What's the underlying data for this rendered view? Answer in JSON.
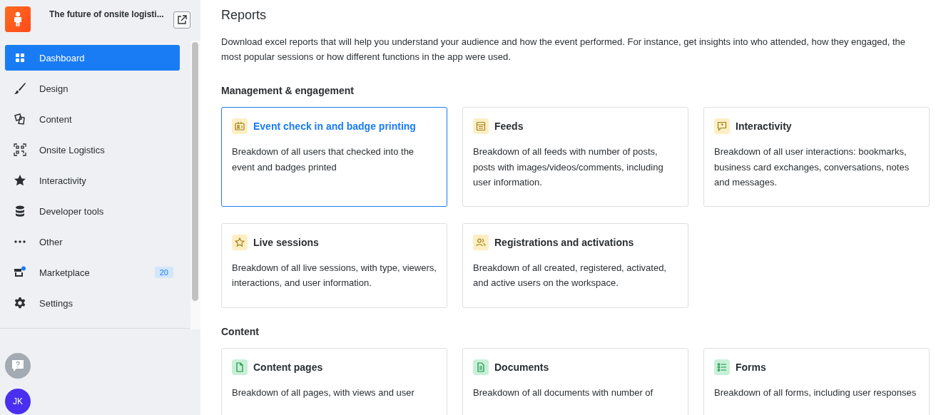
{
  "workspace": {
    "title": "The future of onsite logisti..."
  },
  "sidebar": {
    "items": [
      {
        "label": "Dashboard",
        "selected": true
      },
      {
        "label": "Design",
        "selected": false
      },
      {
        "label": "Content",
        "selected": false
      },
      {
        "label": "Onsite Logistics",
        "selected": false
      },
      {
        "label": "Interactivity",
        "selected": false
      },
      {
        "label": "Developer tools",
        "selected": false
      },
      {
        "label": "Other",
        "selected": false
      },
      {
        "label": "Marketplace",
        "selected": false,
        "badge": "20"
      },
      {
        "label": "Settings",
        "selected": false
      }
    ],
    "avatar": "JK"
  },
  "page": {
    "title": "Reports",
    "description": "Download excel reports that will help you understand your audience and how the event performed. For instance, get insights into who attended, how they engaged, the most popular sessions or how different functions in the app were used."
  },
  "sections": [
    {
      "title": "Management & engagement",
      "cards": [
        {
          "title": "Event check in and badge printing",
          "description": "Breakdown of all users that checked into the event and badges printed",
          "selected": true
        },
        {
          "title": "Feeds",
          "description": "Breakdown of all feeds with number of posts, posts with images/videos/comments, including user information.",
          "selected": false
        },
        {
          "title": "Interactivity",
          "description": "Breakdown of all user interactions: bookmarks, business card exchanges, conversations, notes and messages.",
          "selected": false
        },
        {
          "title": "Live sessions",
          "description": "Breakdown of all live sessions, with type, viewers, interactions, and user information.",
          "selected": false
        },
        {
          "title": "Registrations and activations",
          "description": "Breakdown of all created, registered, activated, and active users on the workspace.",
          "selected": false
        }
      ]
    },
    {
      "title": "Content",
      "cards": [
        {
          "title": "Content pages",
          "description": "Breakdown of all pages, with views and user",
          "selected": false
        },
        {
          "title": "Documents",
          "description": "Breakdown of all documents with number of",
          "selected": false
        },
        {
          "title": "Forms",
          "description": "Breakdown of all forms, including user responses",
          "selected": false
        }
      ]
    }
  ]
}
